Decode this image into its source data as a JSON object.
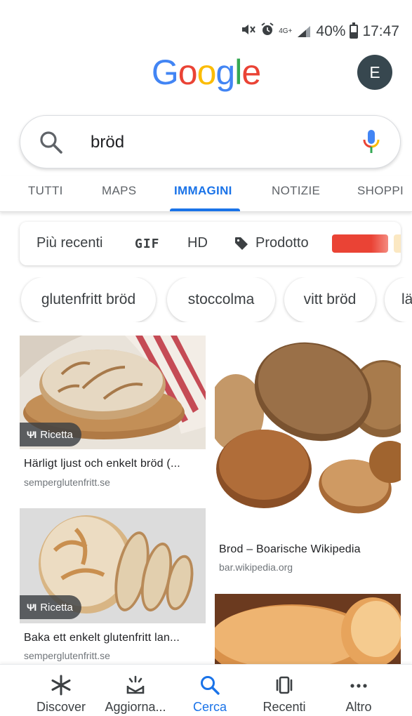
{
  "status_bar": {
    "network": "4G+",
    "battery": "40%",
    "battery_level": 0.4,
    "time": "17:47"
  },
  "header": {
    "logo_letters": [
      "G",
      "o",
      "o",
      "g",
      "l",
      "e"
    ],
    "logo_colors": [
      "#4285f4",
      "#ea4335",
      "#fbbc05",
      "#4285f4",
      "#34a853",
      "#ea4335"
    ],
    "avatar_letter": "E",
    "avatar_color": "#37474f"
  },
  "search": {
    "query": "bröd",
    "icon": "search-icon",
    "mic_icon": "mic-icon"
  },
  "tabs": [
    {
      "label": "TUTTI",
      "active": false
    },
    {
      "label": "MAPS",
      "active": false
    },
    {
      "label": "IMMAGINI",
      "active": true
    },
    {
      "label": "NOTIZIE",
      "active": false
    },
    {
      "label": "SHOPPI",
      "active": false
    }
  ],
  "filters": {
    "recent": "Più recenti",
    "gif": "GIF",
    "hd": "HD",
    "product": "Prodotto",
    "color_swatch": "#ea4335"
  },
  "related_chips": [
    "glutenfritt bröd",
    "stoccolma",
    "vitt bröd",
    "lä"
  ],
  "results": [
    {
      "badge": "Ricetta",
      "title": "Härligt ljust och enkelt bröd (...",
      "domain": "semperglutenfritt.se"
    },
    {
      "badge": "",
      "title": "Brod – Boarische Wikipedia",
      "domain": "bar.wikipedia.org"
    },
    {
      "badge": "Ricetta",
      "title": "Baka ett enkelt glutenfritt lan...",
      "domain": "semperglutenfritt.se"
    },
    {
      "badge": "",
      "title": "",
      "domain": ""
    }
  ],
  "bottom_nav": [
    {
      "label": "Discover",
      "icon": "asterisk-icon",
      "active": false
    },
    {
      "label": "Aggiorna...",
      "icon": "updates-icon",
      "active": false
    },
    {
      "label": "Cerca",
      "icon": "search-icon",
      "active": true
    },
    {
      "label": "Recenti",
      "icon": "recent-tabs-icon",
      "active": false
    },
    {
      "label": "Altro",
      "icon": "more-dots-icon",
      "active": false
    }
  ],
  "colors": {
    "accent": "#1a73e8",
    "text_secondary": "#5f6368"
  }
}
